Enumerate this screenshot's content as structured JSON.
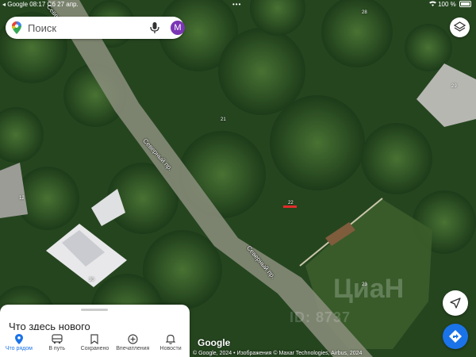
{
  "status_bar": {
    "app": "Google",
    "time": "08:17",
    "date": "Сб 27 апр.",
    "battery": "100 %"
  },
  "search": {
    "placeholder": "Поиск",
    "avatar_letter": "M"
  },
  "map": {
    "street_labels": [
      "Северный пр.",
      "Северный пр.",
      "Север"
    ],
    "house_numbers": [
      "28",
      "29",
      "21",
      "22",
      "12",
      "23",
      "30"
    ],
    "watermark": "ЦиаН",
    "watermark_id": "ID: 8737"
  },
  "brand": {
    "logo": "Google",
    "attribution": "© Google, 2024 • Изображения © Maxar Technologies, Airbus, 2024"
  },
  "sheet": {
    "title": "Что здесь нового"
  },
  "nav": [
    {
      "label": "Что рядом",
      "icon": "location-pin-icon",
      "active": true
    },
    {
      "label": "В путь",
      "icon": "bus-icon",
      "active": false
    },
    {
      "label": "Сохранено",
      "icon": "bookmark-icon",
      "active": false
    },
    {
      "label": "Впечатления",
      "icon": "plus-circle-icon",
      "active": false
    },
    {
      "label": "Новости",
      "icon": "bell-icon",
      "active": false
    }
  ],
  "colors": {
    "accent": "#1a73e8",
    "avatar": "#7b35b5",
    "marker": "#e32b2b"
  }
}
